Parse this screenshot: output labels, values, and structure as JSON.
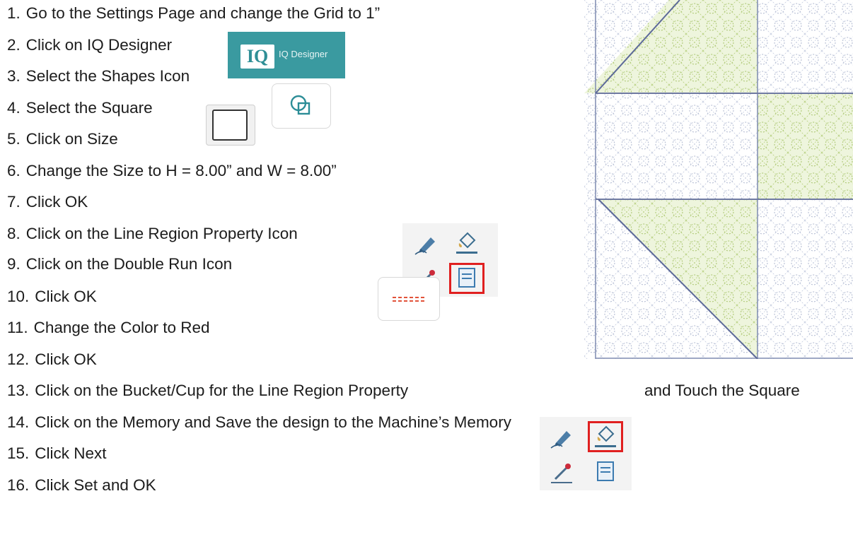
{
  "steps": [
    {
      "num": "1.",
      "text": "Go to the Settings Page and change the Grid to 1”"
    },
    {
      "num": "2.",
      "text": "Click on IQ Designer"
    },
    {
      "num": "3.",
      "text": "Select the Shapes Icon"
    },
    {
      "num": "4.",
      "text": "Select the Square"
    },
    {
      "num": "5.",
      "text": "Click on Size"
    },
    {
      "num": "6.",
      "text": "Change the Size to H = 8.00” and W = 8.00”"
    },
    {
      "num": "7.",
      "text": "Click OK"
    },
    {
      "num": "8.",
      "text": "Click on the Line Region Property Icon"
    },
    {
      "num": "9.",
      "text": "Click on the Double Run Icon"
    },
    {
      "num": "10.",
      "text": "Click OK"
    },
    {
      "num": "11.",
      "text": "Change the Color to Red"
    },
    {
      "num": "12.",
      "text": "Click OK"
    },
    {
      "num": "13.",
      "text": "Click on the Bucket/Cup for the Line Region Property",
      "suffix": "and Touch the Square"
    },
    {
      "num": "14.",
      "text": "Click on the Memory and Save the design to the Machine’s Memory"
    },
    {
      "num": "15.",
      "text": "Click Next"
    },
    {
      "num": "16.",
      "text": "Click Set and OK"
    }
  ],
  "iq_badge": {
    "mark": "IQ",
    "label": "IQ Designer",
    "color": "#3a9aa0"
  },
  "icons": {
    "shapes": "shapes-icon",
    "square": "square-shape-icon",
    "line_property": "line-pen-icon",
    "region_property": "region-bucket-icon",
    "line_dropper": "line-dropper-icon",
    "region_dropper": "region-dropper-icon",
    "double_run": "double-run-icon"
  },
  "colors": {
    "highlight": "#e02020",
    "double_run": "#e2533a",
    "quilt_blue": "#7f8bb0",
    "quilt_green": "#a7c46b"
  }
}
